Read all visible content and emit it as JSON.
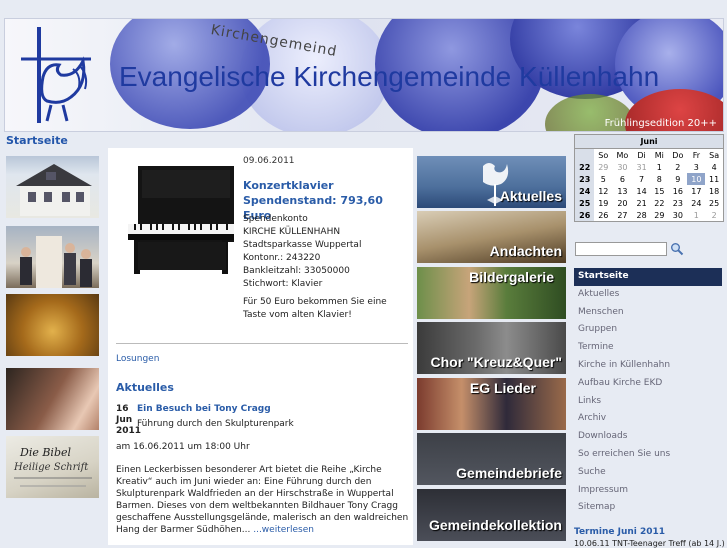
{
  "banner": {
    "title": "Evangelische Kirchengemeinde Küllenhahn",
    "arc_text": "Kirchengemeind",
    "edition": "Frühlingsedition 20++"
  },
  "left": {
    "home_link": "Startseite"
  },
  "main": {
    "date": "09.06.2011",
    "headline": "Konzertklavier Spendenstand: 793,60 Euro",
    "donation_lines": [
      "Spendenkonto",
      "KIRCHE KÜLLENHAHN",
      "Stadtsparkasse Wuppertal",
      "Kontonr.:  243220",
      "Bankleitzahl:  33050000",
      "Stichwort: Klavier"
    ],
    "tagline": "Für 50 Euro bekommen Sie eine Taste vom alten Klavier!",
    "losungen": "Losungen",
    "section_title": "Aktuelles",
    "event": {
      "day": "16",
      "month": "Jun",
      "year": "2011",
      "title": "Ein Besuch bei Tony Cragg",
      "subtitle": "Führung durch den Skulpturenpark",
      "time": "am 16.06.2011 um 18:00 Uhr",
      "body": "Einen Leckerbissen besonderer Art bietet die Reihe „Kirche Kreativ“ auch im Juni wieder an: Eine Führung durch den Skulpturenpark Waldfrieden an der Hirschstraße in Wuppertal Barmen. Dieses von dem weltbekannten Bildhauer Tony Cragg geschaffene Ausstellungsgelände, malerisch an den waldreichen Hang  der Barmer Südhöhen...",
      "more": "...weiterlesen"
    }
  },
  "image_links": [
    "Aktuelles",
    "Andachten",
    "Bildergalerie",
    "Chor \"Kreuz&Quer\"",
    "EG Lieder",
    "Gemeindebriefe",
    "Gemeindekollektion"
  ],
  "calendar": {
    "month": "Juni",
    "weekdays": [
      "",
      "So",
      "Mo",
      "Di",
      "Mi",
      "Do",
      "Fr",
      "Sa"
    ],
    "rows": [
      [
        "22",
        "29",
        "30",
        "31",
        "1",
        "2",
        "3",
        "4"
      ],
      [
        "23",
        "5",
        "6",
        "7",
        "8",
        "9",
        "10",
        "11"
      ],
      [
        "24",
        "12",
        "13",
        "14",
        "15",
        "16",
        "17",
        "18"
      ],
      [
        "25",
        "19",
        "20",
        "21",
        "22",
        "23",
        "24",
        "25"
      ],
      [
        "26",
        "26",
        "27",
        "28",
        "29",
        "30",
        "1",
        "2"
      ]
    ],
    "today": "10"
  },
  "nav": [
    "Startseite",
    "Aktuelles",
    "Menschen",
    "Gruppen",
    "Termine",
    "Kirche in Küllenhahn",
    "Aufbau Kirche EKD",
    "Links",
    "Archiv",
    "Downloads",
    "So erreichen Sie uns",
    "Suche",
    "Impressum",
    "Sitemap"
  ],
  "termine": {
    "title": "Termine Juni 2011",
    "row": "10.06.11 TNT-Teenager Treff (ab 14 J.)"
  },
  "colors": {
    "link": "#2a5ca8",
    "nav_active": "#1c2f57",
    "title": "#1f3aa0"
  }
}
